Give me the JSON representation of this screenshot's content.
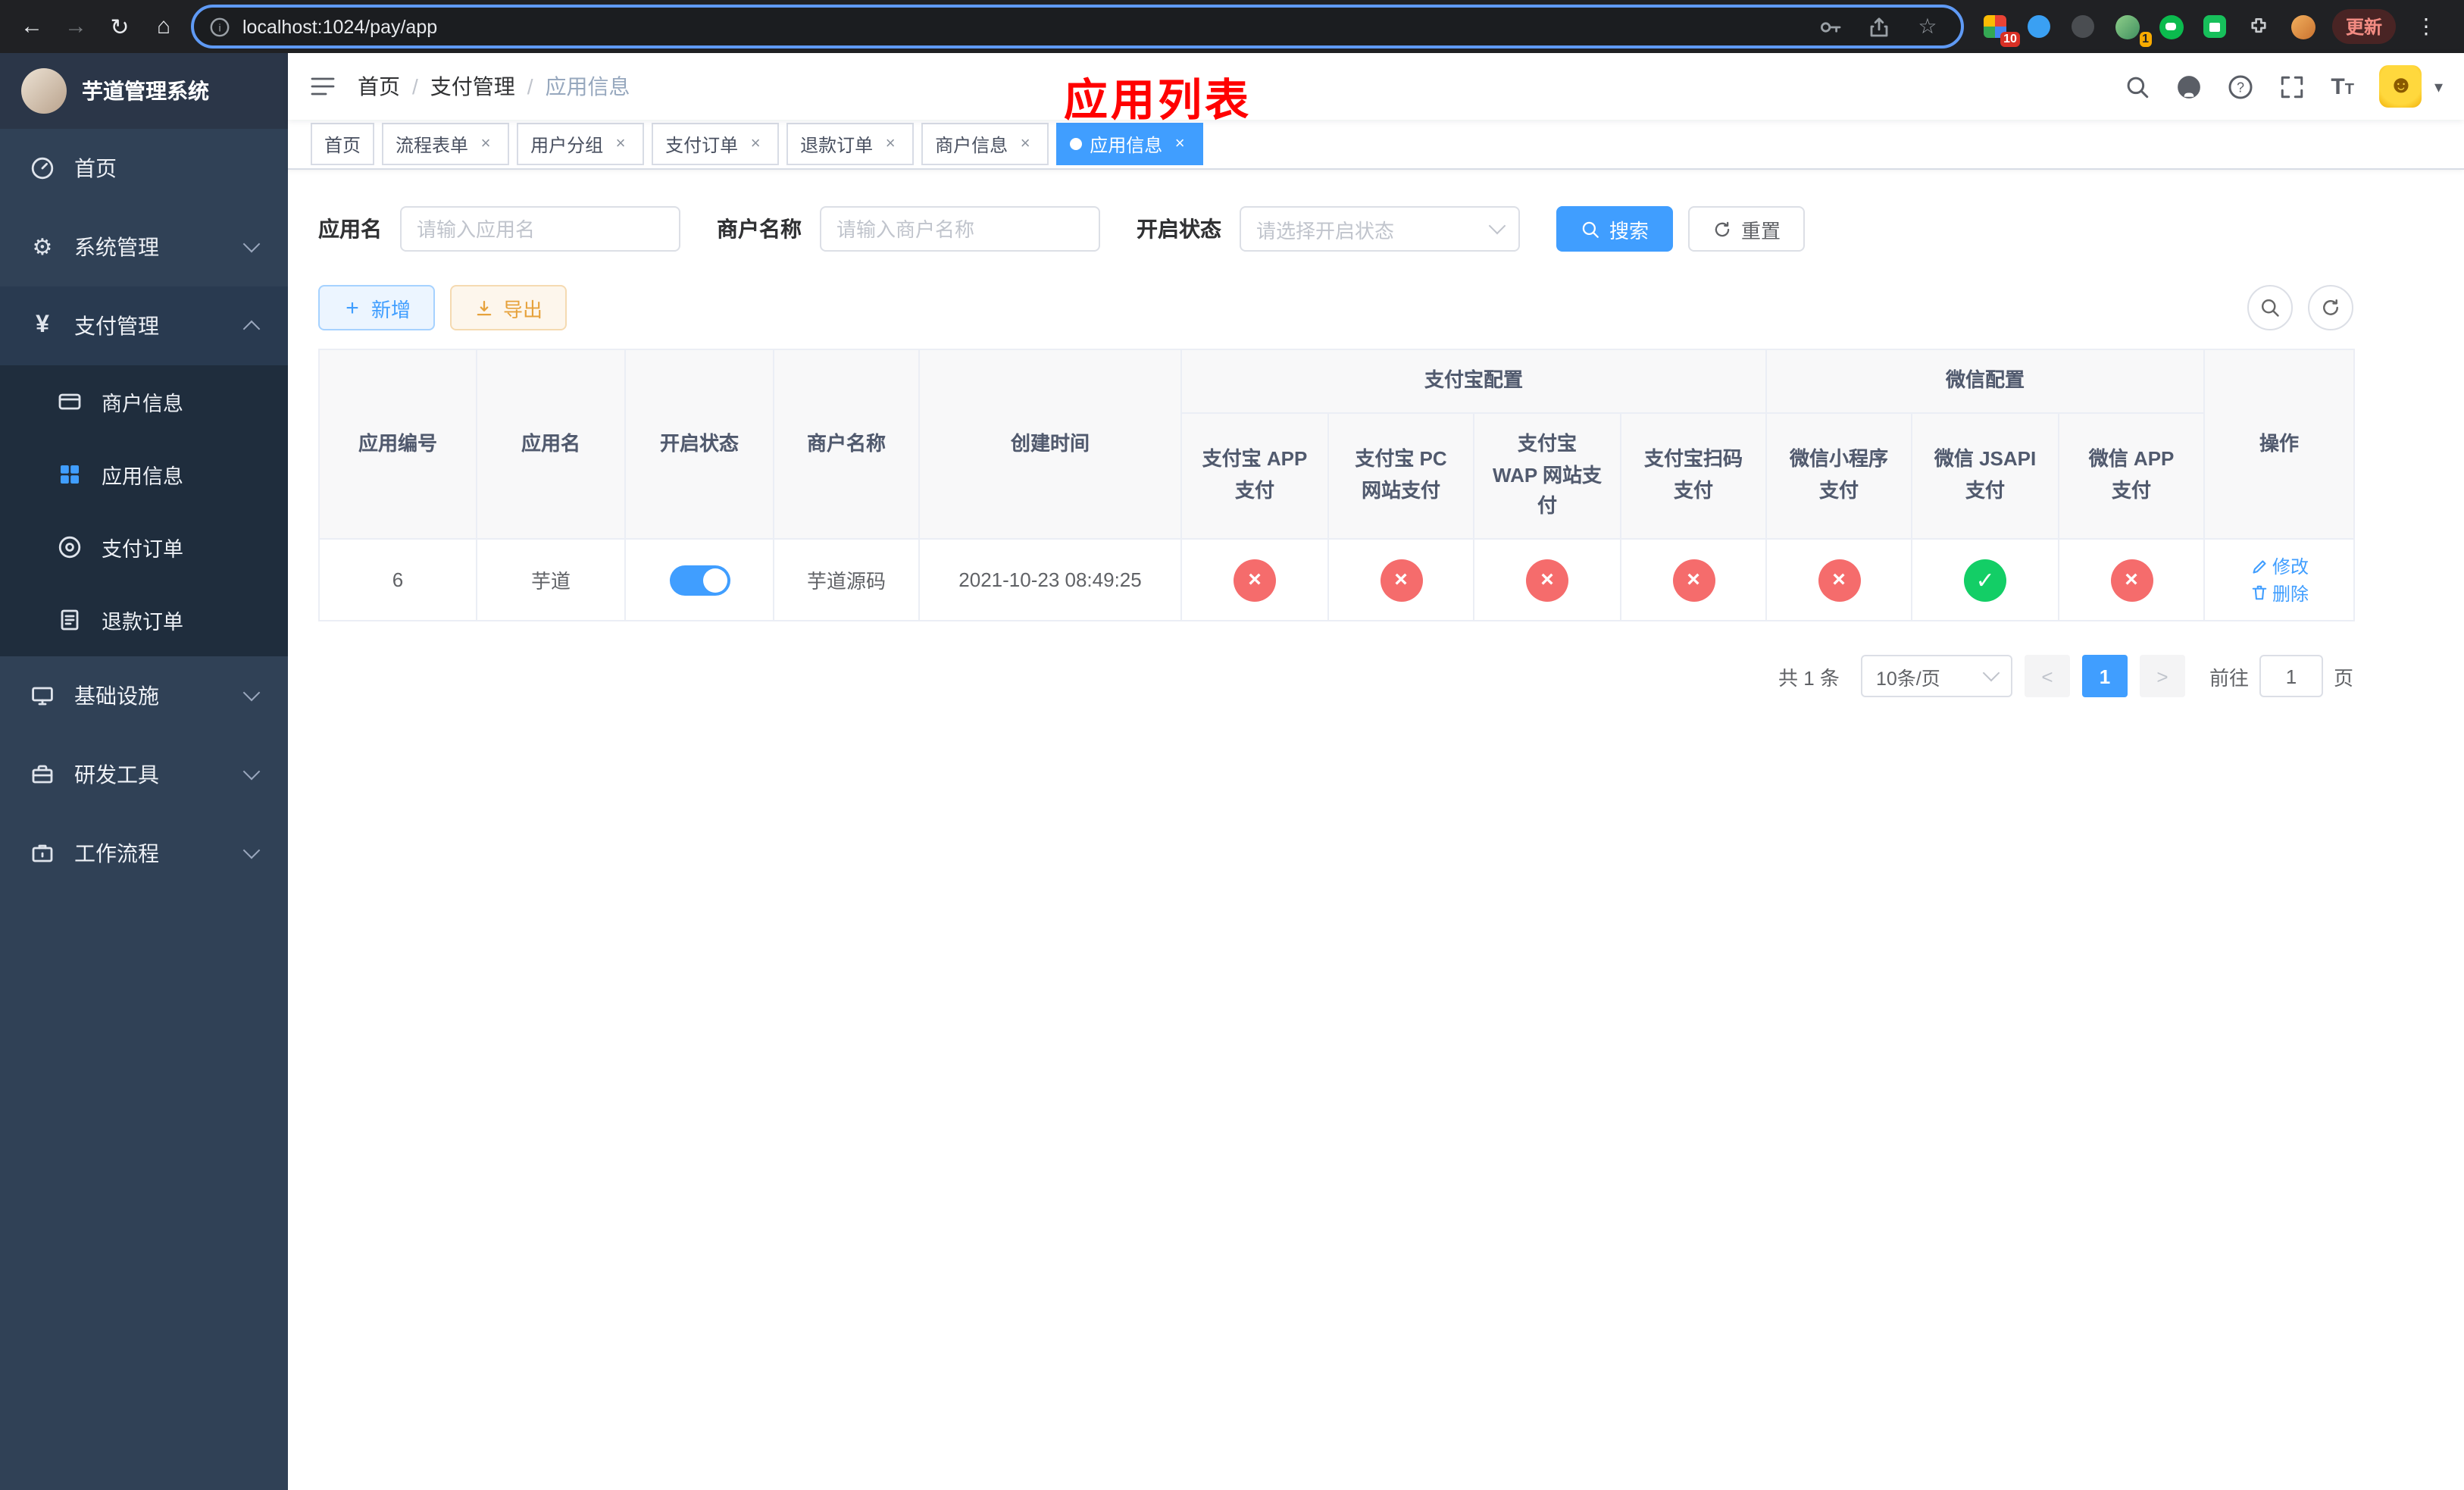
{
  "browser": {
    "url": "localhost:1024/pay/app",
    "update_label": "更新",
    "extension_badge_count": "10",
    "profile_badge_count": "1"
  },
  "icons": {
    "back": "←",
    "forward": "→",
    "reload": "↻",
    "home": "⌂",
    "star": "☆",
    "kebab": "⋮",
    "info": "i",
    "question": "?",
    "gear": "⚙",
    "yen": "¥",
    "slash": "/",
    "caret_down": "▾",
    "face": "☻",
    "font_large": "T",
    "font_small": "T",
    "close": "×",
    "plus": "+",
    "check": "✓",
    "cross": "×",
    "pager_prev": "<",
    "pager_next": ">"
  },
  "sidebar": {
    "title": "芋道管理系统",
    "home": "首页",
    "system": "系统管理",
    "payment": "支付管理",
    "merchant_info": "商户信息",
    "app_info": "应用信息",
    "pay_order": "支付订单",
    "refund_order": "退款订单",
    "infrastructure": "基础设施",
    "dev_tools": "研发工具",
    "workflow": "工作流程"
  },
  "breadcrumb": [
    "首页",
    "支付管理",
    "应用信息"
  ],
  "page_annotation": "应用列表",
  "tabs": [
    {
      "label": "首页",
      "closable": false,
      "active": false
    },
    {
      "label": "流程表单",
      "closable": true,
      "active": false
    },
    {
      "label": "用户分组",
      "closable": true,
      "active": false
    },
    {
      "label": "支付订单",
      "closable": true,
      "active": false
    },
    {
      "label": "退款订单",
      "closable": true,
      "active": false
    },
    {
      "label": "商户信息",
      "closable": true,
      "active": false
    },
    {
      "label": "应用信息",
      "closable": true,
      "active": true
    }
  ],
  "filters": {
    "app_name_label": "应用名",
    "app_name_placeholder": "请输入应用名",
    "merchant_label": "商户名称",
    "merchant_placeholder": "请输入商户名称",
    "status_label": "开启状态",
    "status_placeholder": "请选择开启状态",
    "search_button": "搜索",
    "reset_button": "重置"
  },
  "toolbar": {
    "add_button": "新增",
    "export_button": "导出"
  },
  "table": {
    "columns": [
      "应用编号",
      "应用名",
      "开启状态",
      "商户名称",
      "创建时间",
      "操作"
    ],
    "groups": {
      "alipay": "支付宝配置",
      "wechat": "微信配置"
    },
    "sub_columns": [
      "支付宝 APP 支付",
      "支付宝 PC 网站支付",
      "支付宝 WAP 网站支付",
      "支付宝扫码支付",
      "微信小程序支付",
      "微信 JSAPI 支付",
      "微信 APP 支付"
    ],
    "rows": [
      {
        "id": "6",
        "name": "芋道",
        "enabled": true,
        "merchant": "芋道源码",
        "created_at": "2021-10-23 08:49:25",
        "alipay_app": "disabled",
        "alipay_pc": "disabled",
        "alipay_wap": "disabled",
        "alipay_qr": "disabled",
        "wechat_mini": "disabled",
        "wechat_jsapi": "enabled",
        "wechat_app": "disabled",
        "edit_action": "修改",
        "delete_action": "删除"
      }
    ]
  },
  "pagination": {
    "total": "共 1 条",
    "page_size": "10条/页",
    "current_page": "1",
    "goto_label": "前往",
    "goto_value": "1",
    "goto_unit": "页"
  },
  "colors": {
    "primary": "#409eff",
    "success": "#13ce66",
    "danger": "#f56c6c",
    "warning": "#e6a23c",
    "annotation_red": "#ff0000",
    "sidebar_bg": "#304156",
    "submenu_bg": "#1f2d3d",
    "chrome_bg": "#202124"
  }
}
